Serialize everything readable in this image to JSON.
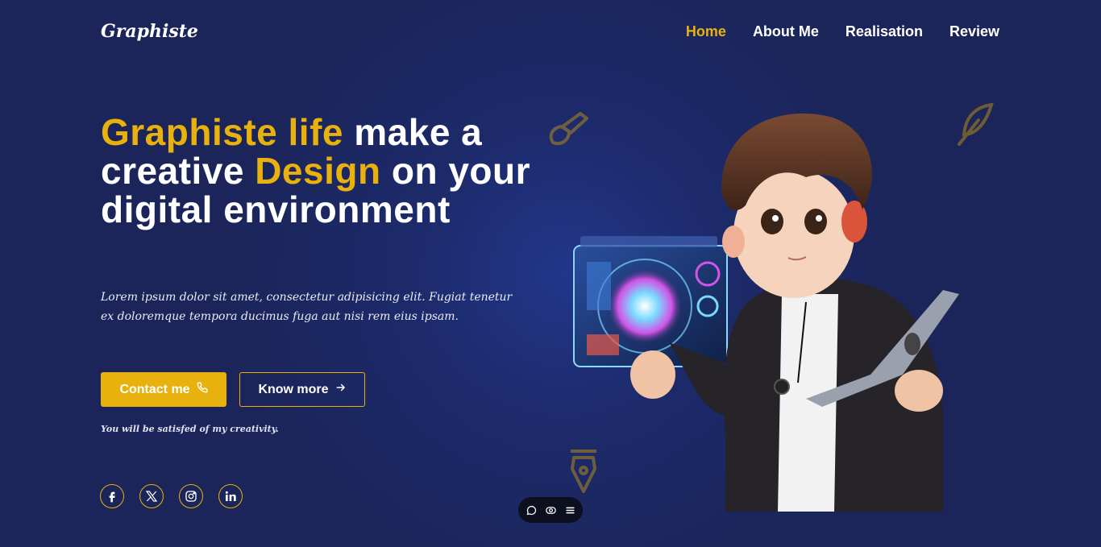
{
  "brand": {
    "logo": "Graphiste"
  },
  "nav": {
    "items": [
      {
        "label": "Home",
        "active": true
      },
      {
        "label": "About Me",
        "active": false
      },
      {
        "label": "Realisation",
        "active": false
      },
      {
        "label": "Review",
        "active": false
      }
    ]
  },
  "hero": {
    "title_part1_gold": "Graphiste life",
    "title_part2": " make a creative ",
    "title_part3_gold": "Design",
    "title_part4": " on your digital environment",
    "description": "Lorem ipsum dolor sit amet, consectetur adipisicing elit. Fugiat tenetur ex doloremque tempora ducimus fuga aut nisi rem eius ipsam.",
    "contact_label": "Contact me",
    "know_more_label": "Know more",
    "tagline": "You will be satisfed of my creativity."
  },
  "socials": [
    "facebook",
    "x",
    "instagram",
    "linkedin"
  ],
  "colors": {
    "background": "#1b2559",
    "accent": "#e8b10d",
    "text": "#ffffff"
  }
}
